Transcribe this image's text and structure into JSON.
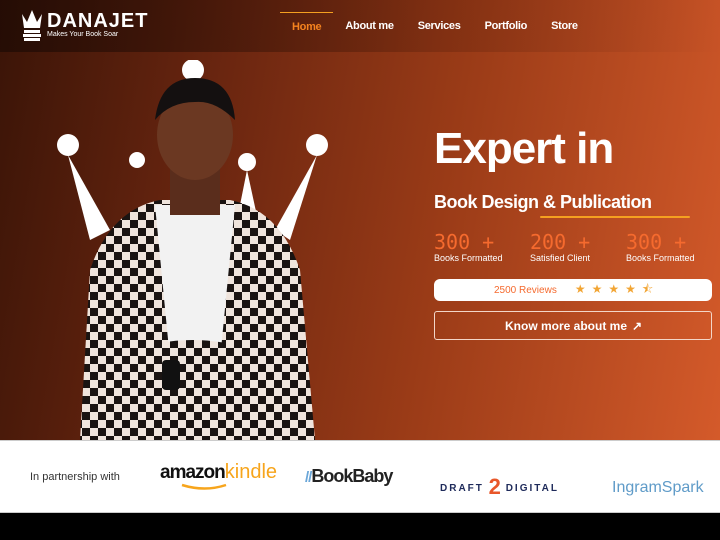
{
  "brand": {
    "name": "DANAJET",
    "tagline": "Makes Your Book Soar"
  },
  "nav": [
    {
      "label": "Home",
      "active": true
    },
    {
      "label": "About me"
    },
    {
      "label": "Services"
    },
    {
      "label": "Portfolio"
    },
    {
      "label": "Store"
    }
  ],
  "hero": {
    "title_line1": "Expert in",
    "title_line2": "Book Design & Publication",
    "stats": [
      {
        "num": "300  +",
        "label": "Books Formatted"
      },
      {
        "num": "200  +",
        "label": "Satisfied Client"
      },
      {
        "num": "300  +",
        "label": "Books Formatted"
      }
    ],
    "reviews": {
      "text": "2500 Reviews",
      "rating": 4.5
    },
    "cta": "Know more about me"
  },
  "partners": {
    "label": "In partnership with",
    "logos": [
      "amazonkindle",
      "BookBaby",
      "DRAFT2DIGITAL",
      "IngramSpark"
    ],
    "amazon": "amazon",
    "kindle": "kindle",
    "bookbaby": "BookBaby",
    "d2d_a": "DRAFT",
    "d2d_b": "DIGITAL",
    "ingram": "IngramSpark"
  },
  "colors": {
    "accent": "#f56a2e",
    "star": "#f2a534",
    "nav_active": "#f5831f"
  }
}
